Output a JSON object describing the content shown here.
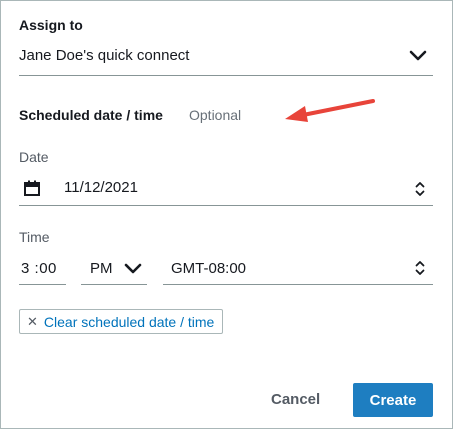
{
  "assign": {
    "label": "Assign to",
    "value": "Jane Doe's quick connect"
  },
  "schedule": {
    "label": "Scheduled date / time",
    "optional": "Optional"
  },
  "date": {
    "label": "Date",
    "value": "11/12/2021"
  },
  "time": {
    "label": "Time",
    "hours": "3",
    "separator": ":",
    "minutes": "00",
    "ampm": "PM",
    "timezone": "GMT-08:00"
  },
  "clear": {
    "icon": "close-icon",
    "label": "Clear scheduled date / time"
  },
  "actions": {
    "cancel": "Cancel",
    "create": "Create"
  },
  "colors": {
    "primary": "#1e7ec1",
    "link": "#0073bb",
    "annotation_arrow": "#e8443a"
  }
}
